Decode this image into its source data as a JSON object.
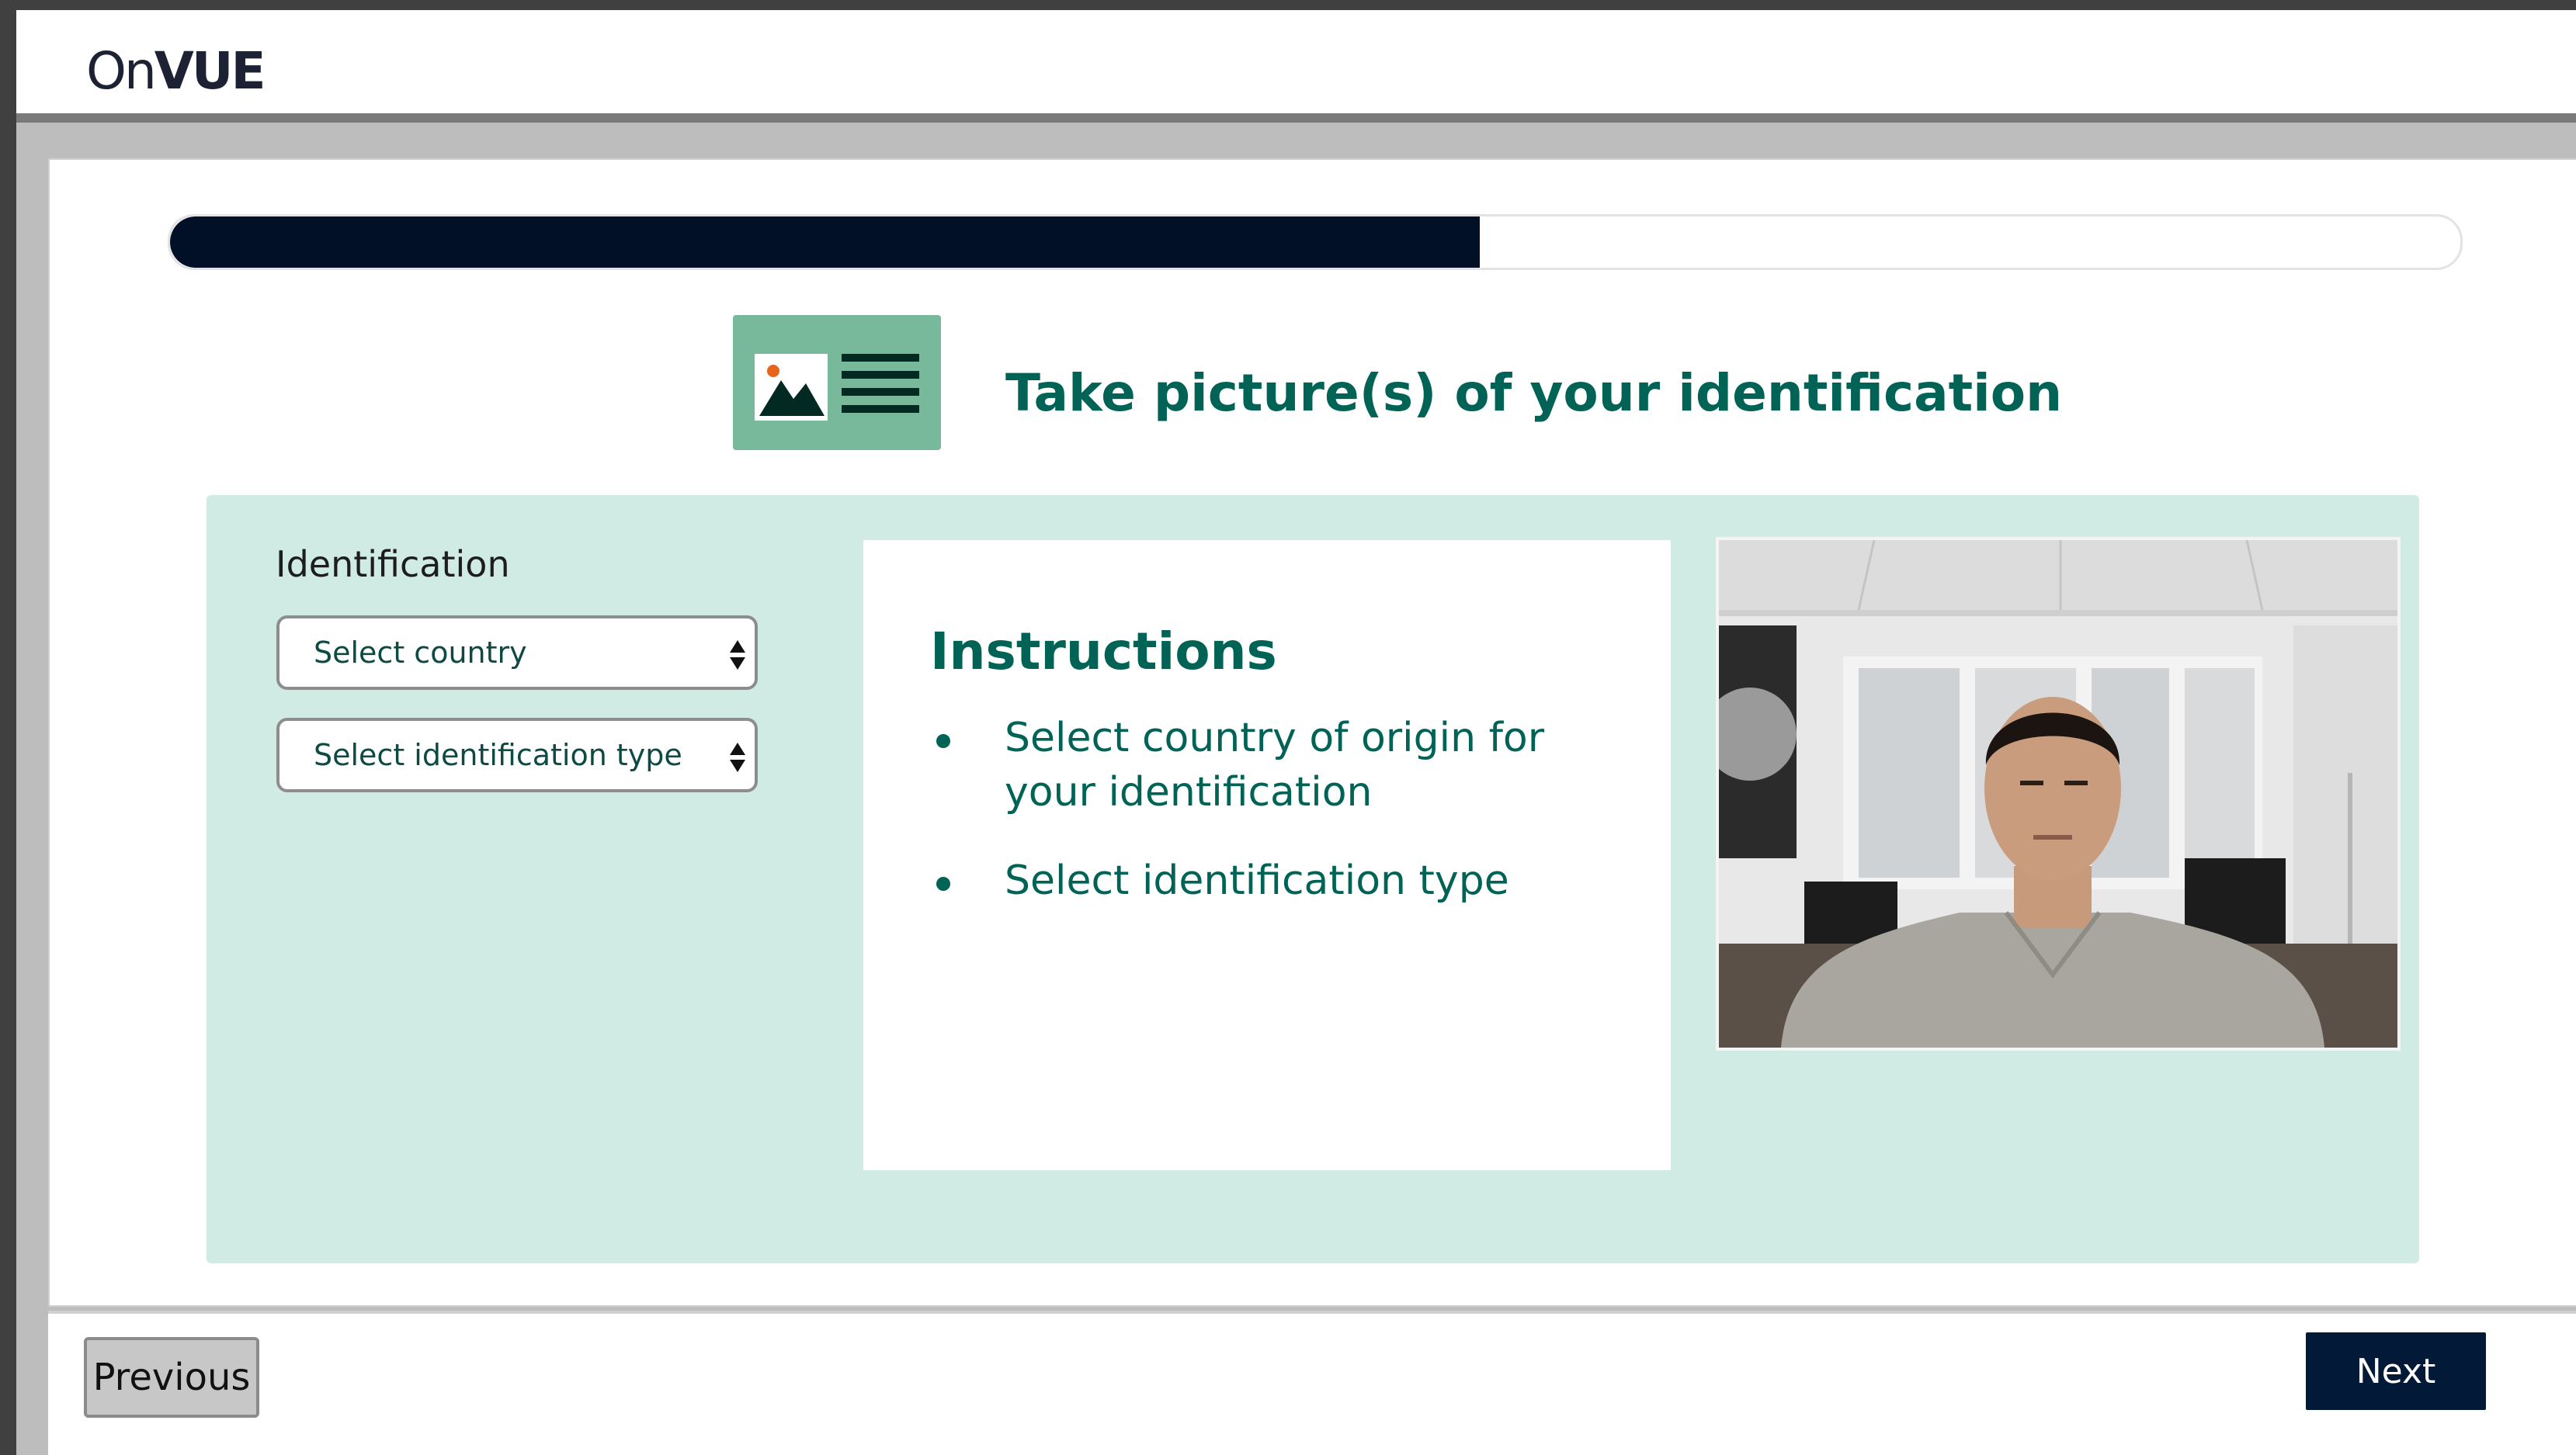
{
  "app": {
    "logo_on": "On",
    "logo_vue": "VUE"
  },
  "progress": {
    "fraction": 0.572
  },
  "page": {
    "title": "Take picture(s) of your identification",
    "heading_icon": "id-card-icon"
  },
  "form": {
    "label": "Identification",
    "country_select": {
      "value": "Select country"
    },
    "id_type_select": {
      "value": "Select identification type"
    }
  },
  "instructions": {
    "title": "Instructions",
    "items": [
      "Select country of origin for your identification",
      "Select identification type"
    ]
  },
  "camera": {
    "description_icon": "webcam-preview-icon"
  },
  "footer": {
    "previous_label": "Previous",
    "next_label": "Next"
  },
  "colors": {
    "brand_teal": "#006355",
    "panel_mint": "#d0ebe4",
    "icon_green": "#78b99c",
    "navy": "#021027"
  }
}
